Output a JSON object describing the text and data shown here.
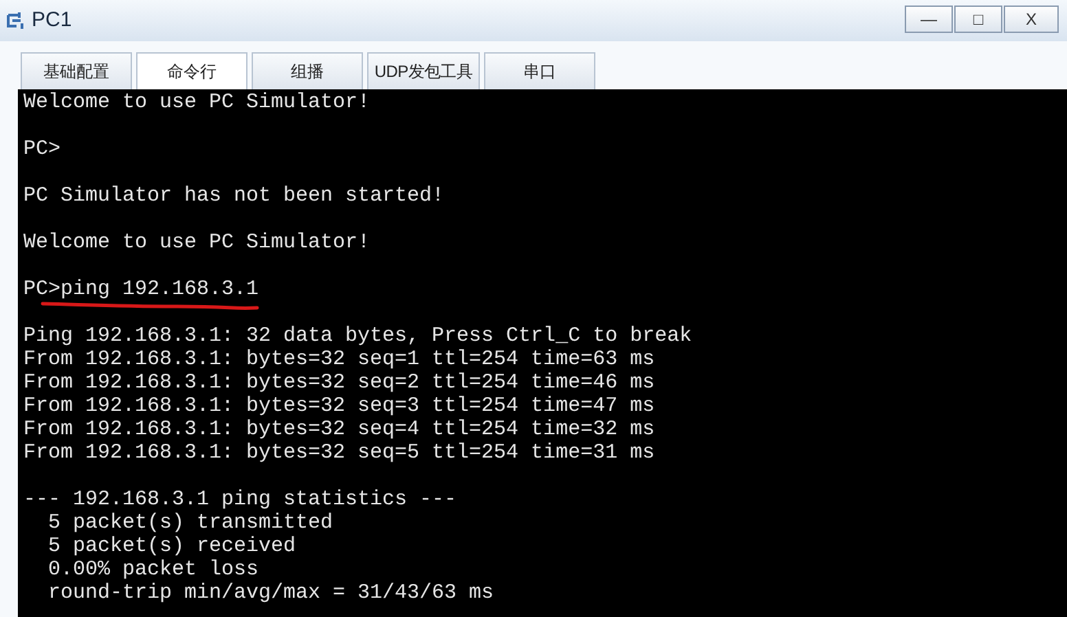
{
  "window": {
    "title": "PC1",
    "controls": [
      {
        "kind": "minimize",
        "label": "—"
      },
      {
        "kind": "maximize",
        "label": "□"
      },
      {
        "kind": "close",
        "label": "X"
      }
    ]
  },
  "tabs": [
    {
      "label": "基础配置",
      "selected": false
    },
    {
      "label": "命令行",
      "selected": true
    },
    {
      "label": "组播",
      "selected": false
    },
    {
      "label": "UDP发包工具",
      "selected": false
    },
    {
      "label": "串口",
      "selected": false
    }
  ],
  "terminal": {
    "blocks": [
      {
        "lines": [
          {
            "text": "Welcome to use PC Simulator!",
            "underlined": false
          }
        ]
      },
      {
        "lines": [
          {
            "text": "PC>",
            "underlined": false
          }
        ]
      },
      {
        "lines": [
          {
            "text": "PC Simulator has not been started!",
            "underlined": false
          }
        ]
      },
      {
        "lines": [
          {
            "text": "Welcome to use PC Simulator!",
            "underlined": false
          }
        ]
      },
      {
        "lines": [
          {
            "text": "PC>ping 192.168.3.1",
            "underlined": true
          }
        ]
      },
      {
        "lines": [
          {
            "text": "Ping 192.168.3.1: 32 data bytes, Press Ctrl_C to break",
            "underlined": false
          },
          {
            "text": "From 192.168.3.1: bytes=32 seq=1 ttl=254 time=63 ms",
            "underlined": false
          },
          {
            "text": "From 192.168.3.1: bytes=32 seq=2 ttl=254 time=46 ms",
            "underlined": false
          },
          {
            "text": "From 192.168.3.1: bytes=32 seq=3 ttl=254 time=47 ms",
            "underlined": false
          },
          {
            "text": "From 192.168.3.1: bytes=32 seq=4 ttl=254 time=32 ms",
            "underlined": false
          },
          {
            "text": "From 192.168.3.1: bytes=32 seq=5 ttl=254 time=31 ms",
            "underlined": false
          }
        ]
      },
      {
        "lines": [
          {
            "text": "--- 192.168.3.1 ping statistics ---",
            "underlined": false
          },
          {
            "text": "  5 packet(s) transmitted",
            "underlined": false
          },
          {
            "text": "  5 packet(s) received",
            "underlined": false
          },
          {
            "text": "  0.00% packet loss",
            "underlined": false
          },
          {
            "text": "  round-trip min/avg/max = 31/43/63 ms",
            "underlined": false
          }
        ]
      }
    ]
  }
}
